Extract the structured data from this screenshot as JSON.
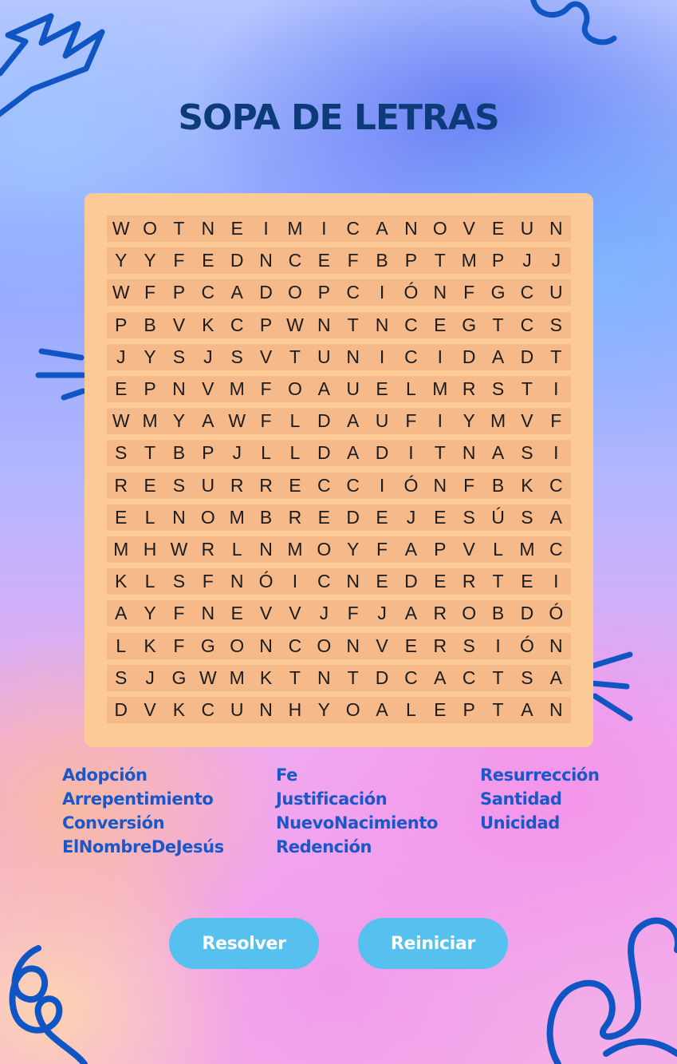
{
  "title": "SOPA DE LETRAS",
  "grid": [
    [
      "W",
      "O",
      "T",
      "N",
      "E",
      "I",
      "M",
      "I",
      "C",
      "A",
      "N",
      "O",
      "V",
      "E",
      "U",
      "N"
    ],
    [
      "Y",
      "Y",
      "F",
      "E",
      "D",
      "N",
      "C",
      "E",
      "F",
      "B",
      "P",
      "T",
      "M",
      "P",
      "J",
      "J"
    ],
    [
      "W",
      "F",
      "P",
      "C",
      "A",
      "D",
      "O",
      "P",
      "C",
      "I",
      "Ó",
      "N",
      "F",
      "G",
      "C",
      "U"
    ],
    [
      "P",
      "B",
      "V",
      "K",
      "C",
      "P",
      "W",
      "N",
      "T",
      "N",
      "C",
      "E",
      "G",
      "T",
      "C",
      "S"
    ],
    [
      "J",
      "Y",
      "S",
      "J",
      "S",
      "V",
      "T",
      "U",
      "N",
      "I",
      "C",
      "I",
      "D",
      "A",
      "D",
      "T"
    ],
    [
      "E",
      "P",
      "N",
      "V",
      "M",
      "F",
      "O",
      "A",
      "U",
      "E",
      "L",
      "M",
      "R",
      "S",
      "T",
      "I"
    ],
    [
      "W",
      "M",
      "Y",
      "A",
      "W",
      "F",
      "L",
      "D",
      "A",
      "U",
      "F",
      "I",
      "Y",
      "M",
      "V",
      "F"
    ],
    [
      "S",
      "T",
      "B",
      "P",
      "J",
      "L",
      "L",
      "D",
      "A",
      "D",
      "I",
      "T",
      "N",
      "A",
      "S",
      "I"
    ],
    [
      "R",
      "E",
      "S",
      "U",
      "R",
      "R",
      "E",
      "C",
      "C",
      "I",
      "Ó",
      "N",
      "F",
      "B",
      "K",
      "C"
    ],
    [
      "E",
      "L",
      "N",
      "O",
      "M",
      "B",
      "R",
      "E",
      "D",
      "E",
      "J",
      "E",
      "S",
      "Ú",
      "S",
      "A"
    ],
    [
      "M",
      "H",
      "W",
      "R",
      "L",
      "N",
      "M",
      "O",
      "Y",
      "F",
      "A",
      "P",
      "V",
      "L",
      "M",
      "C"
    ],
    [
      "K",
      "L",
      "S",
      "F",
      "N",
      "Ó",
      "I",
      "C",
      "N",
      "E",
      "D",
      "E",
      "R",
      "T",
      "E",
      "I"
    ],
    [
      "A",
      "Y",
      "F",
      "N",
      "E",
      "V",
      "V",
      "J",
      "F",
      "J",
      "A",
      "R",
      "O",
      "B",
      "D",
      "Ó"
    ],
    [
      "L",
      "K",
      "F",
      "G",
      "O",
      "N",
      "C",
      "O",
      "N",
      "V",
      "E",
      "R",
      "S",
      "I",
      "Ó",
      "N"
    ],
    [
      "S",
      "J",
      "G",
      "W",
      "M",
      "K",
      "T",
      "N",
      "T",
      "D",
      "C",
      "A",
      "C",
      "T",
      "S",
      "A"
    ],
    [
      "D",
      "V",
      "K",
      "C",
      "U",
      "N",
      "H",
      "Y",
      "O",
      "A",
      "L",
      "E",
      "P",
      "T",
      "A",
      "N"
    ]
  ],
  "word_columns": [
    [
      "Adopción",
      "Arrepentimiento",
      "Conversión",
      "ElNombreDeJesús"
    ],
    [
      "Fe",
      "Justificación",
      "NuevoNacimiento",
      "Redención"
    ],
    [
      "Resurrección",
      "Santidad",
      "Unicidad"
    ]
  ],
  "buttons": {
    "solve": "Resolver",
    "reset": "Reiniciar"
  },
  "colors": {
    "title": "#0d3a78",
    "words": "#1a57c8",
    "board": "#fcca96",
    "row": "#f6b98a",
    "button": "#56c0ef",
    "doodle": "#0f55c4"
  }
}
